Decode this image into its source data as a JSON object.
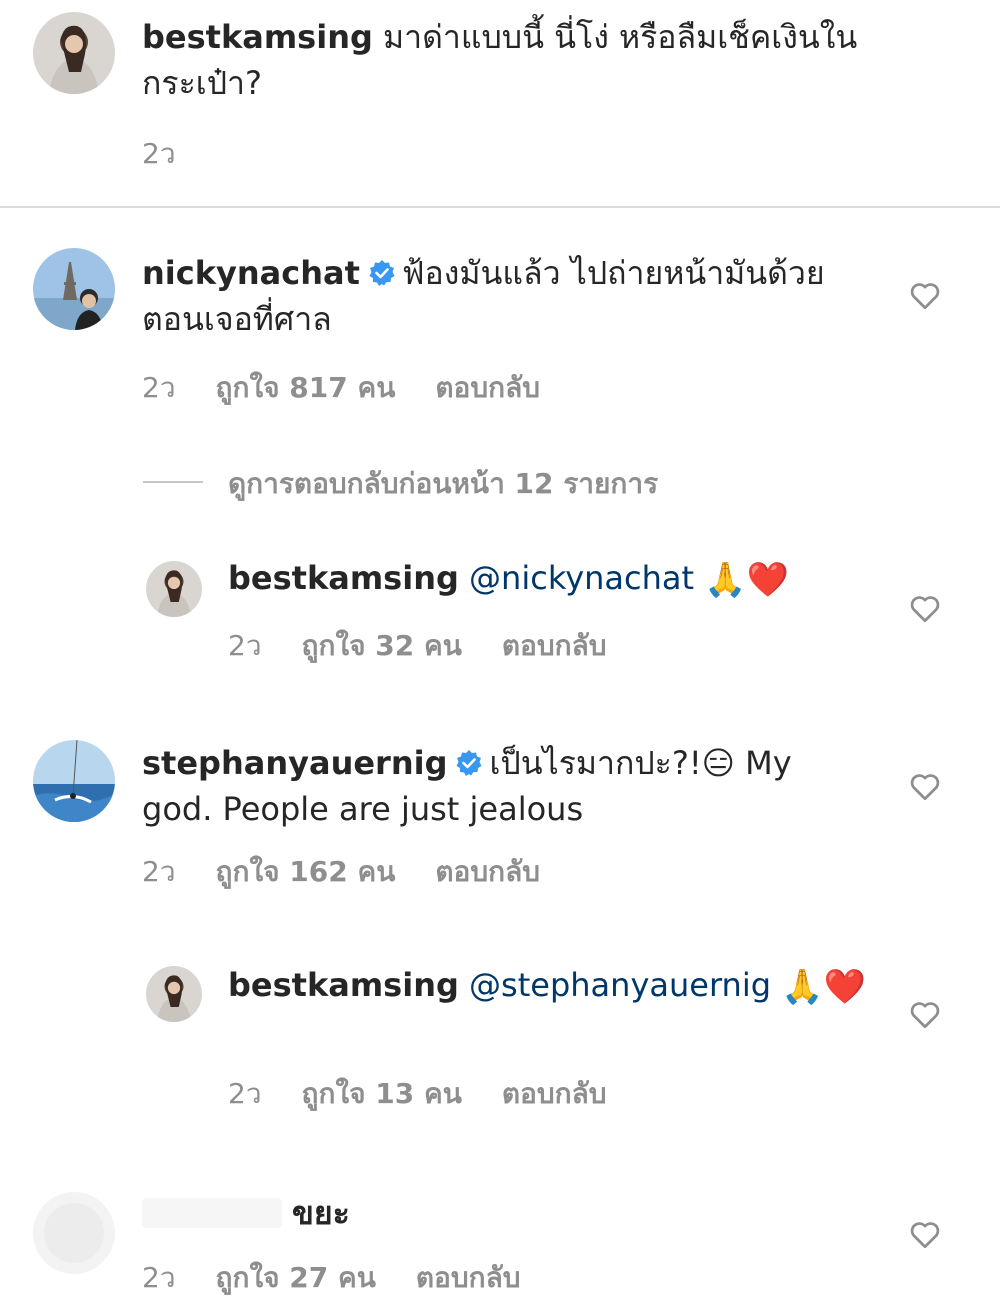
{
  "comments": [
    {
      "username": "bestkamsing",
      "text": "มาด่าแบบนี้ นี่โง่ หรือลืมเช็คเงินในกระเป๋า?",
      "time": "2ว"
    },
    {
      "username": "nickynachat",
      "verified": true,
      "text": "ฟ้องมันแล้ว ไปถ่ายหน้ามันด้วย ตอนเจอที่ศาล",
      "time": "2ว",
      "likes": "ถูกใจ 817 คน",
      "reply": "ตอบกลับ"
    },
    {
      "view_replies": "ดูการตอบกลับก่อนหน้า 12 รายการ"
    },
    {
      "username": "bestkamsing",
      "mention": "@nickynachat",
      "emoji": "🙏❤️",
      "time": "2ว",
      "likes": "ถูกใจ 32 คน",
      "reply": "ตอบกลับ"
    },
    {
      "username": "stephanyauernig",
      "verified": true,
      "text": "เป็นไรมากปะ?!😑 My god. People are just jealous",
      "time": "2ว",
      "likes": "ถูกใจ 162 คน",
      "reply": "ตอบกลับ"
    },
    {
      "username": "bestkamsing",
      "mention": "@stephanyauernig",
      "emoji": "🙏❤️",
      "time": "2ว",
      "likes": "ถูกใจ 13 คน",
      "reply": "ตอบกลับ"
    },
    {
      "text": "ขยะ",
      "time": "2ว",
      "likes": "ถูกใจ 27 คน",
      "reply": "ตอบกลับ"
    }
  ],
  "colors": {
    "text": "#262626",
    "meta": "#8e8e8e",
    "mention": "#00376b",
    "verified": "#3897f0",
    "divider": "#dbdbdb"
  },
  "icons": [
    "heart-outline-icon",
    "verified-badge-icon"
  ]
}
